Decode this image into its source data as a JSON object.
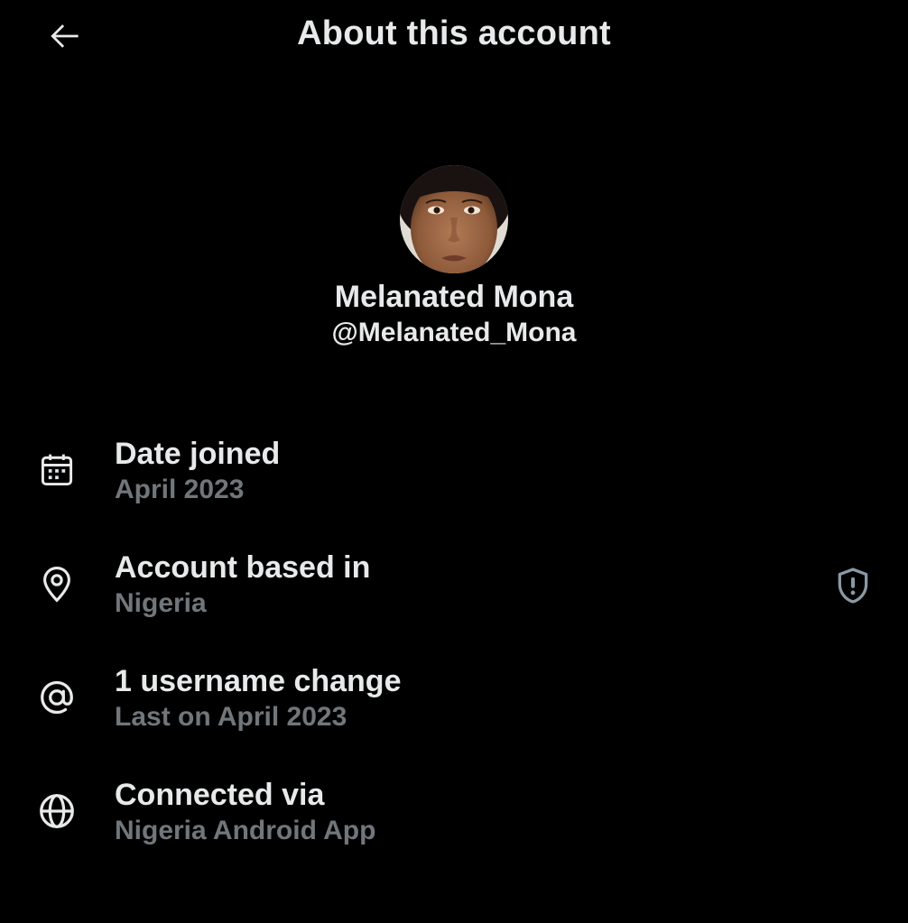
{
  "header": {
    "title": "About this account",
    "back_icon": "arrow-left-icon"
  },
  "profile": {
    "display_name": "Melanated Mona",
    "handle": "@Melanated_Mona"
  },
  "rows": [
    {
      "icon": "calendar-icon",
      "title": "Date joined",
      "subtitle": "April 2023"
    },
    {
      "icon": "location-pin-icon",
      "title": "Account based in",
      "subtitle": "Nigeria",
      "action_icon": "shield-alert-icon"
    },
    {
      "icon": "at-sign-icon",
      "title": "1 username change",
      "subtitle": "Last on April 2023"
    },
    {
      "icon": "globe-icon",
      "title": "Connected via",
      "subtitle": "Nigeria Android App"
    }
  ],
  "colors": {
    "background": "#000000",
    "primary_text": "#e7e9ea",
    "secondary_text": "#71767b"
  }
}
